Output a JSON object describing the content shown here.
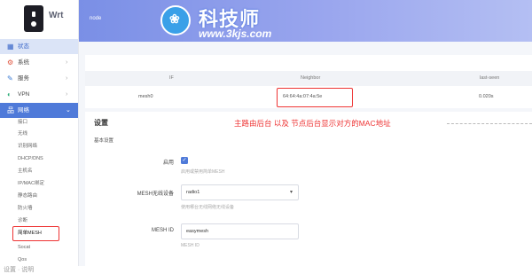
{
  "app": {
    "logo_text": "Wrt"
  },
  "topbar": {
    "breadcrumb": "node"
  },
  "watermark": {
    "icon_glyph": "❀",
    "title": "科技师",
    "url": "www.3kjs.com"
  },
  "sidebar": {
    "items": [
      {
        "label": "状态",
        "icon": "grid-icon",
        "glyph": "▦"
      },
      {
        "label": "系统",
        "icon": "gear-icon",
        "glyph": "⚙"
      },
      {
        "label": "服务",
        "icon": "wrench-icon",
        "glyph": "✎"
      },
      {
        "label": "VPN",
        "icon": "vpn-icon",
        "glyph": "◐"
      },
      {
        "label": "网络",
        "icon": "network-icon",
        "glyph": "品"
      }
    ],
    "chevron": "›",
    "chevron_open": "⌄",
    "sub_items": [
      "接口",
      "无线",
      "识别网络",
      "DHCP/DNS",
      "主机名",
      "IP/MAC绑定",
      "静态路由",
      "防火墙",
      "诊断",
      "简单MESH",
      "Socat",
      "Qos"
    ]
  },
  "neighbor_table": {
    "headers": [
      "IF",
      "Neighbor",
      "last-seen"
    ],
    "rows": [
      {
        "iface": "mesh0",
        "neighbor": "64:64:4a:07:4a:5e",
        "last_seen": "0.020s"
      }
    ]
  },
  "settings": {
    "title": "设置",
    "subtitle": "基本设置",
    "annotation": "主路由后台 以及 节点后台显示对方的MAC地址",
    "enable_label": "启用",
    "enable_checked": true,
    "enable_hint": "启用或禁用简单MESH",
    "radio_label": "MESH无线设备",
    "radio_value": "radio1",
    "radio_hint": "使用哪台无线网络无线设备",
    "id_label": "MESH ID",
    "id_value": "easymesh",
    "id_hint": "MESH ID"
  },
  "footer": {
    "text": "设置 · 说明"
  }
}
